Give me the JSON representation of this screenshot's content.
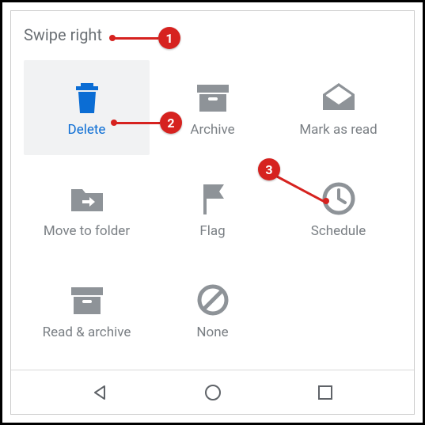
{
  "header": {
    "title": "Swipe right"
  },
  "options": [
    {
      "label": "Delete",
      "icon": "trash-icon",
      "selected": true
    },
    {
      "label": "Archive",
      "icon": "archive-icon",
      "selected": false
    },
    {
      "label": "Mark as read",
      "icon": "envelope-icon",
      "selected": false
    },
    {
      "label": "Move to folder",
      "icon": "folder-icon",
      "selected": false
    },
    {
      "label": "Flag",
      "icon": "flag-icon",
      "selected": false
    },
    {
      "label": "Schedule",
      "icon": "clock-icon",
      "selected": false
    },
    {
      "label": "Read & archive",
      "icon": "archive-icon",
      "selected": false
    },
    {
      "label": "None",
      "icon": "none-icon",
      "selected": false
    }
  ],
  "annotations": [
    {
      "num": "1"
    },
    {
      "num": "2"
    },
    {
      "num": "3"
    }
  ],
  "colors": {
    "accent": "#0b6dd4",
    "muted": "#8e9398",
    "annotation": "#d6221f"
  }
}
